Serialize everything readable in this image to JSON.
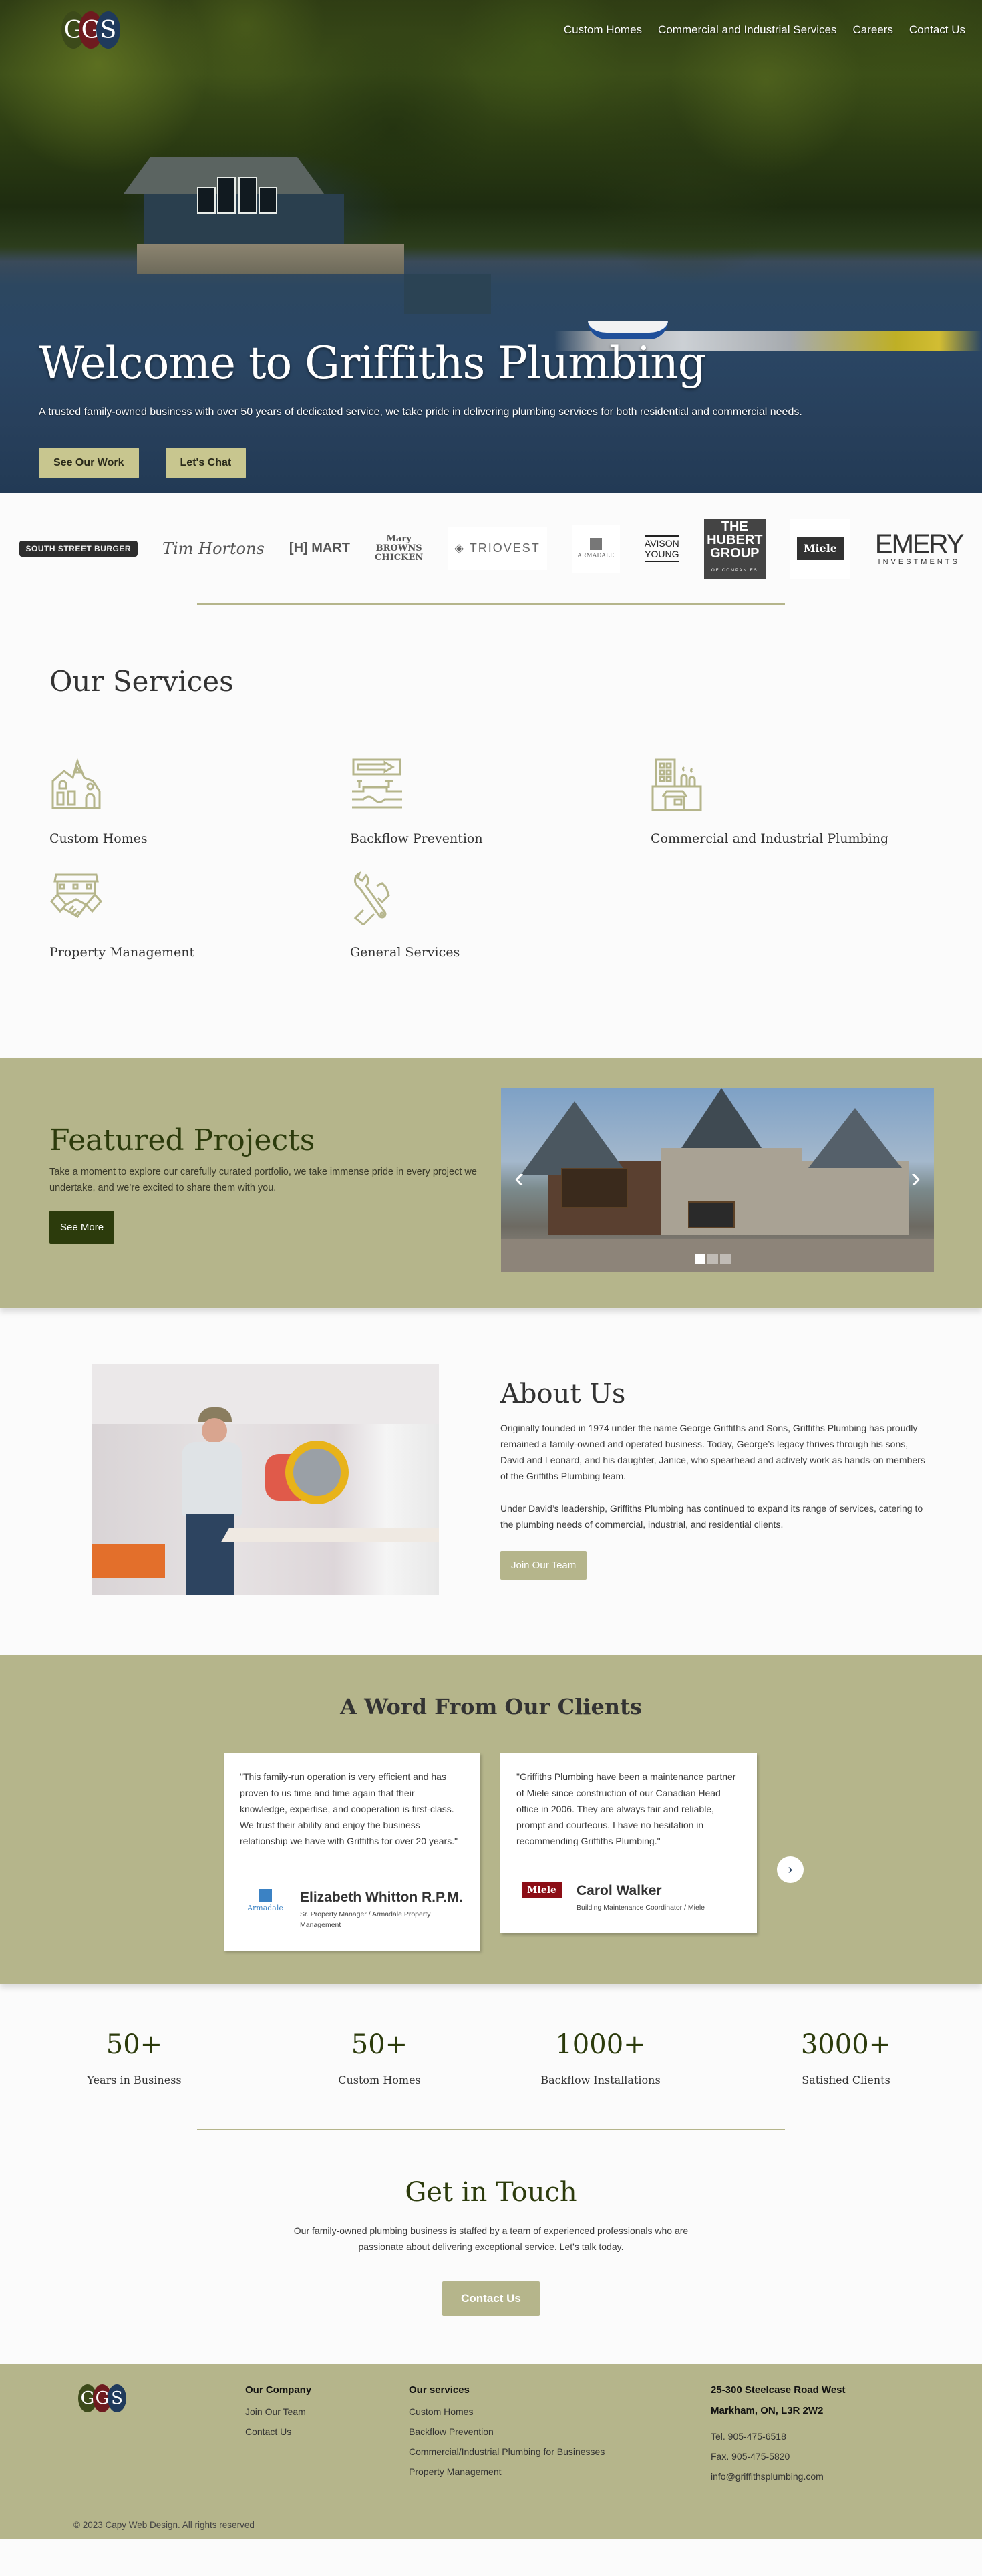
{
  "header": {
    "logo_letters": [
      "G",
      "G",
      "S"
    ],
    "nav": [
      "Custom Homes",
      "Commercial and Industrial Services",
      "Careers",
      "Contact Us"
    ]
  },
  "hero": {
    "title": "Welcome to Griffiths Plumbing",
    "subtitle": "A trusted family-owned business with over 50 years of dedicated service, we take pride in delivering plumbing services for both residential and commercial needs.",
    "buttons": [
      "See Our Work",
      "Let's Chat"
    ]
  },
  "client_logos": [
    "South Street Burger",
    "Tim Hortons",
    "H Mart",
    "Mary Brown's Chicken",
    "Triovest",
    "Armadale Property Management",
    "Avison Young",
    "The Hubert Group of Companies",
    "Miele",
    "Emery Investments"
  ],
  "services": {
    "title": "Our Services",
    "items": [
      {
        "label": "Custom Homes",
        "icon": "house-icon"
      },
      {
        "label": "Backflow Prevention",
        "icon": "backflow-valve-icon"
      },
      {
        "label": "Commercial and Industrial Plumbing",
        "icon": "factory-icon"
      },
      {
        "label": "Property Management",
        "icon": "handshake-icon"
      },
      {
        "label": "General Services",
        "icon": "wrench-hand-icon"
      }
    ]
  },
  "featured": {
    "title": "Featured Projects",
    "body": "Take a moment to explore our carefully curated portfolio, we take immense pride in every project we undertake, and we’re excited to share them with you.",
    "button": "See More",
    "carousel": {
      "slides": 3,
      "active_slide": 1
    }
  },
  "about": {
    "title": "About Us",
    "paragraphs": [
      "Originally founded in 1974 under the name George Griffiths and Sons, Griffiths Plumbing has proudly remained a family-owned and operated business. Today, George’s legacy thrives through his sons, David and Leonard, and his daughter, Janice, who spearhead and actively work as hands-on members of the Griffiths Plumbing team.",
      "Under David’s leadership, Griffiths Plumbing has continued to expand its range of services, catering to the plumbing needs of commercial, industrial, and residential clients."
    ],
    "button": "Join Our Team"
  },
  "testimonials": {
    "title": "A Word From Our Clients",
    "items": [
      {
        "quote": "\"This family-run operation is very efficient and has proven to us time and time again that their knowledge, expertise, and cooperation is first-class. We trust their ability and enjoy the business relationship we have with Griffiths for over 20 years.\"",
        "name": "Elizabeth Whitton R.P.M.",
        "role": "Sr. Property Manager / Armadale Property Management",
        "company_logo": "Armadale"
      },
      {
        "quote": "\"Griffiths Plumbing have been a maintenance partner of Miele since construction of our Canadian Head office in 2006. They are always fair and reliable, prompt and courteous. I have no hesitation in recommending Griffiths Plumbing.\"",
        "name": "Carol Walker",
        "role": "Building Maintenance Coordinator / Miele",
        "company_logo": "Miele"
      }
    ]
  },
  "stats": [
    {
      "value": "50+",
      "label": "Years in Business"
    },
    {
      "value": "50+",
      "label": "Custom Homes"
    },
    {
      "value": "1000+",
      "label": "Backflow Installations"
    },
    {
      "value": "3000+",
      "label": "Satisfied Clients"
    }
  ],
  "contact": {
    "title": "Get in Touch",
    "body": "Our family-owned plumbing business is staffed by a team of experienced professionals who are passionate about delivering exceptional service.  Let's talk today.",
    "button": "Contact Us"
  },
  "footer": {
    "company": {
      "heading": "Our Company",
      "links": [
        "Join Our Team",
        "Contact Us"
      ]
    },
    "services": {
      "heading": "Our services",
      "links": [
        "Custom Homes",
        "Backflow Prevention",
        "Commercial/Industrial Plumbing for Businesses",
        "Property Management"
      ]
    },
    "address": [
      "25-300 Steelcase Road West",
      "Markham, ON, L3R 2W2"
    ],
    "tel": "Tel. 905-475-6518",
    "fax": "Fax. 905-475-5820",
    "email": "info@griffithsplumbing.com",
    "copyright": "© 2023 Capy Web Design. All rights reserved"
  },
  "colors": {
    "accent_tan": "#b5b58b",
    "dark_green": "#2c3b0c",
    "logo_green": "#3c4a1a",
    "logo_red": "#6e1a1f",
    "logo_blue": "#1f3a5c"
  }
}
